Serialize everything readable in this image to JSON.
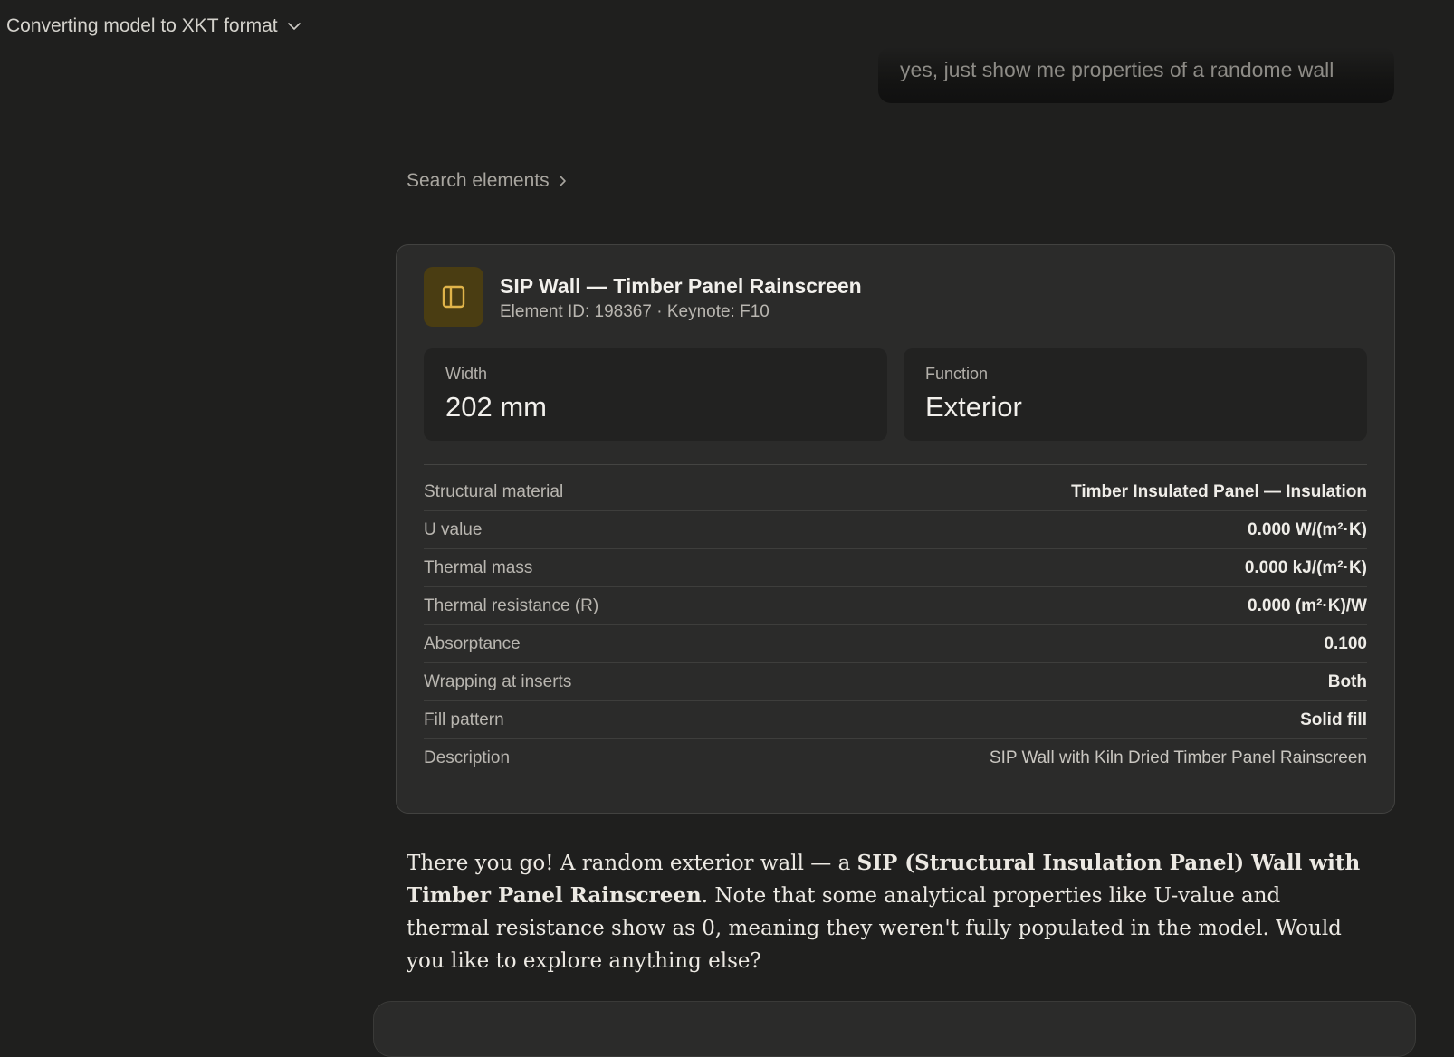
{
  "header": {
    "title": "Converting model to XKT format"
  },
  "user_message": "yes, just show me properties of a randome wall",
  "search_link": {
    "label": "Search elements"
  },
  "element_card": {
    "title": "SIP Wall — Timber Panel Rainscreen",
    "subtitle": "Element ID: 198367 · Keynote: F10",
    "icon": "wall-panel-icon",
    "accent_color": "#e0b44a",
    "stats": [
      {
        "label": "Width",
        "value": "202 mm"
      },
      {
        "label": "Function",
        "value": "Exterior"
      }
    ],
    "properties": [
      {
        "label": "Structural material",
        "value": "Timber Insulated Panel — Insulation"
      },
      {
        "label": "U value",
        "value": "0.000 W/(m²·K)"
      },
      {
        "label": "Thermal mass",
        "value": "0.000 kJ/(m²·K)"
      },
      {
        "label": "Thermal resistance (R)",
        "value": "0.000 (m²·K)/W"
      },
      {
        "label": "Absorptance",
        "value": "0.100"
      },
      {
        "label": "Wrapping at inserts",
        "value": "Both"
      },
      {
        "label": "Fill pattern",
        "value": "Solid fill"
      },
      {
        "label": "Description",
        "value": "SIP Wall with Kiln Dried Timber Panel Rainscreen"
      }
    ]
  },
  "reply": {
    "part1": "There you go! A random exterior wall — a ",
    "bold": "SIP (Structural Insulation Panel) Wall with Timber Panel Rainscreen",
    "part2": ". Note that some analytical properties like U-value and thermal resistance show as 0, meaning they weren't fully populated in the model. Would you like to explore anything else?"
  }
}
